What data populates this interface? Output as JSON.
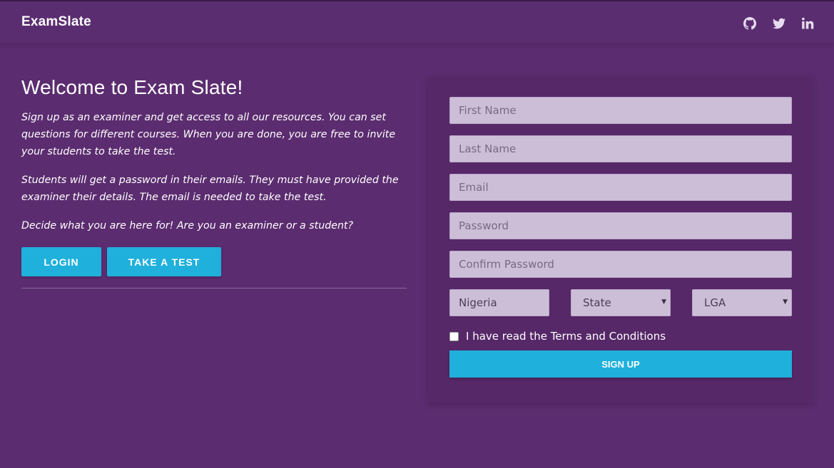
{
  "nav": {
    "brand": "ExamSlate",
    "social_icons": [
      "github-icon",
      "twitter-icon",
      "linkedin-icon"
    ]
  },
  "intro": {
    "title": "Welcome to Exam Slate!",
    "paragraphs": [
      "Sign up as an examiner and get access to all our resources. You can set questions for different courses. When you are done, you are free to invite your students to take the test.",
      "Students will get a password in their emails. They must have provided the examiner their details. The email is needed to take the test.",
      "Decide what you are here for! Are you an examiner or a student?"
    ],
    "login_label": "LOGIN",
    "test_label": "TAKE A TEST"
  },
  "form": {
    "first_name_placeholder": "First Name",
    "last_name_placeholder": "Last Name",
    "email_placeholder": "Email",
    "password_placeholder": "Password",
    "confirm_password_placeholder": "Confirm Password",
    "country_value": "Nigeria",
    "state_value": "State",
    "lga_value": "LGA",
    "terms_label": "I have read the Terms and Conditions",
    "signup_label": "SIGN UP"
  },
  "colors": {
    "background": "#5b2c6f",
    "accent": "#1fb0dc",
    "input_background": "#cdbed8"
  }
}
